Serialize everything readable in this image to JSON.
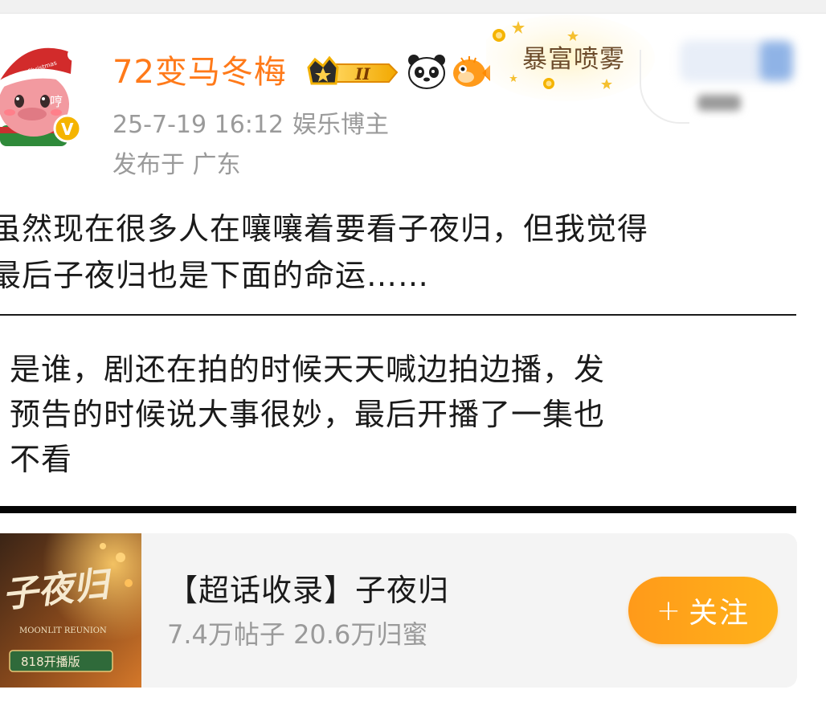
{
  "post": {
    "author": {
      "name": "72变马冬梅",
      "avatar_hat_text": "Merry Christmas",
      "avatar_side_text": "哼",
      "verified_mark": "V",
      "badge_level": "II",
      "badge_icons": [
        "crown-icon",
        "panda-emoji",
        "pufferfish-emoji"
      ],
      "decoration_text": "暴富喷雾"
    },
    "time": "25-7-19 16:12",
    "role": "娱乐博主",
    "location": "发布于 广东",
    "text_lines": [
      "虽然现在很多人在嚷嚷着要看子夜归，但我觉得",
      "最后子夜归也是下面的命运……"
    ],
    "quote_lines": [
      "是谁，剧还在拍的时候天天喊边拍边播，发",
      "预告的时候说大事很妙，最后开播了一集也",
      "不看"
    ]
  },
  "topic": {
    "title": "【超话收录】子夜归",
    "stats": "7.4万帖子 20.6万归蜜",
    "cover_title": "子夜归",
    "cover_subtitle": "MOONLIT REUNION",
    "cover_tag": "818开播版",
    "follow_label": "关注",
    "follow_plus": "+"
  },
  "colors": {
    "username": "#ff7a1a",
    "meta": "#9a9a9a",
    "follow_button": "#ffa81a",
    "card_bg": "#f4f4f4",
    "badge_gold": "#f5b400"
  }
}
